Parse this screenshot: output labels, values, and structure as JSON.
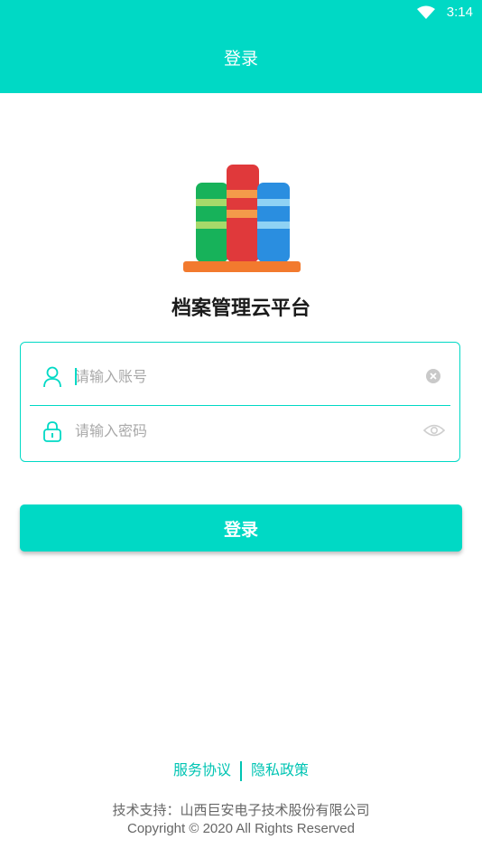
{
  "status_bar": {
    "time": "3:14",
    "icons": [
      "wifi-icon"
    ]
  },
  "app_bar": {
    "title": "登录"
  },
  "logo": {
    "icon": "books-logo"
  },
  "app_name": "档案管理云平台",
  "form": {
    "username": {
      "placeholder": "请输入账号",
      "value": "",
      "icon": "user-icon",
      "action_icon": "clear-icon"
    },
    "password": {
      "placeholder": "请输入密码",
      "value": "",
      "icon": "lock-icon",
      "action_icon": "eye-icon"
    }
  },
  "login_button": "登录",
  "links": {
    "service": "服务协议",
    "privacy": "隐私政策"
  },
  "footer": {
    "support": "技术支持：山西巨安电子技术股份有限公司",
    "copyright": "Copyright © 2020 All Rights Reserved"
  },
  "colors": {
    "accent": "#00d9c5",
    "link": "#00c4b3"
  }
}
